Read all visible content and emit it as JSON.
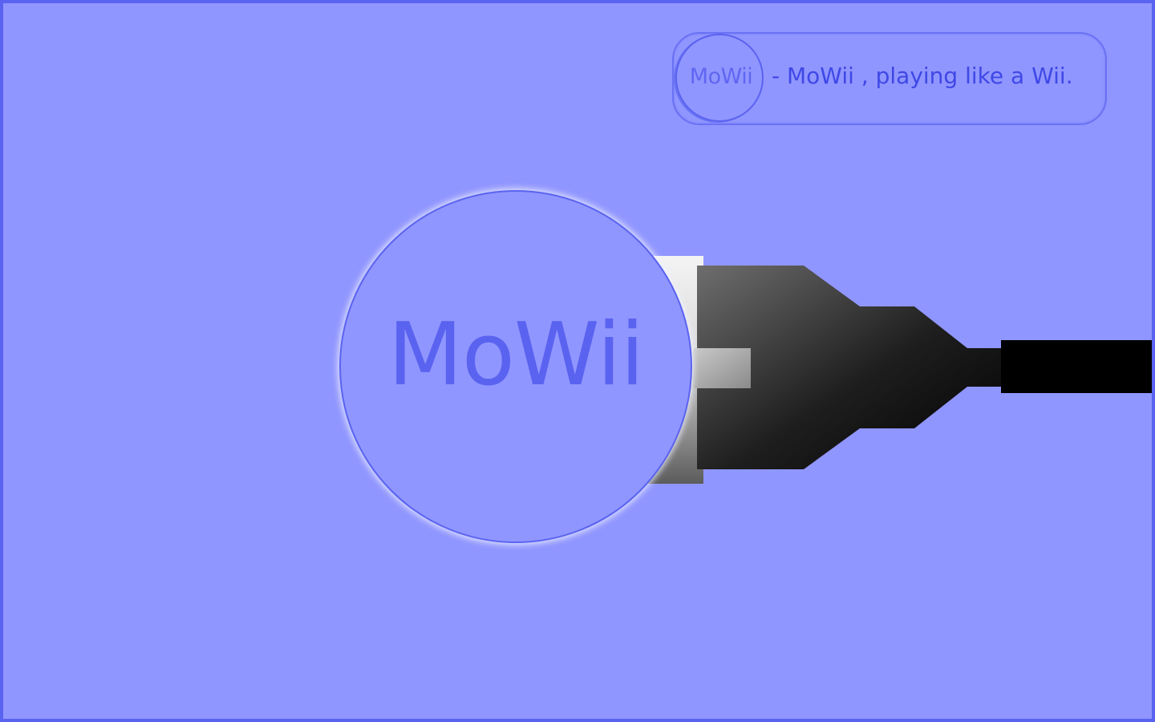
{
  "banner": {
    "logo_text": "MoWii",
    "tagline": "- MoWii , playing like a Wii."
  },
  "main": {
    "logo_text": "MoWii"
  },
  "colors": {
    "background": "#9096ff",
    "border": "#5a63f0",
    "logo_text": "#5a63f0",
    "tagline_text": "#3f48e6",
    "cable": "#000000"
  },
  "icons": {
    "plug": "plug-icon",
    "cable": "cable-icon"
  }
}
